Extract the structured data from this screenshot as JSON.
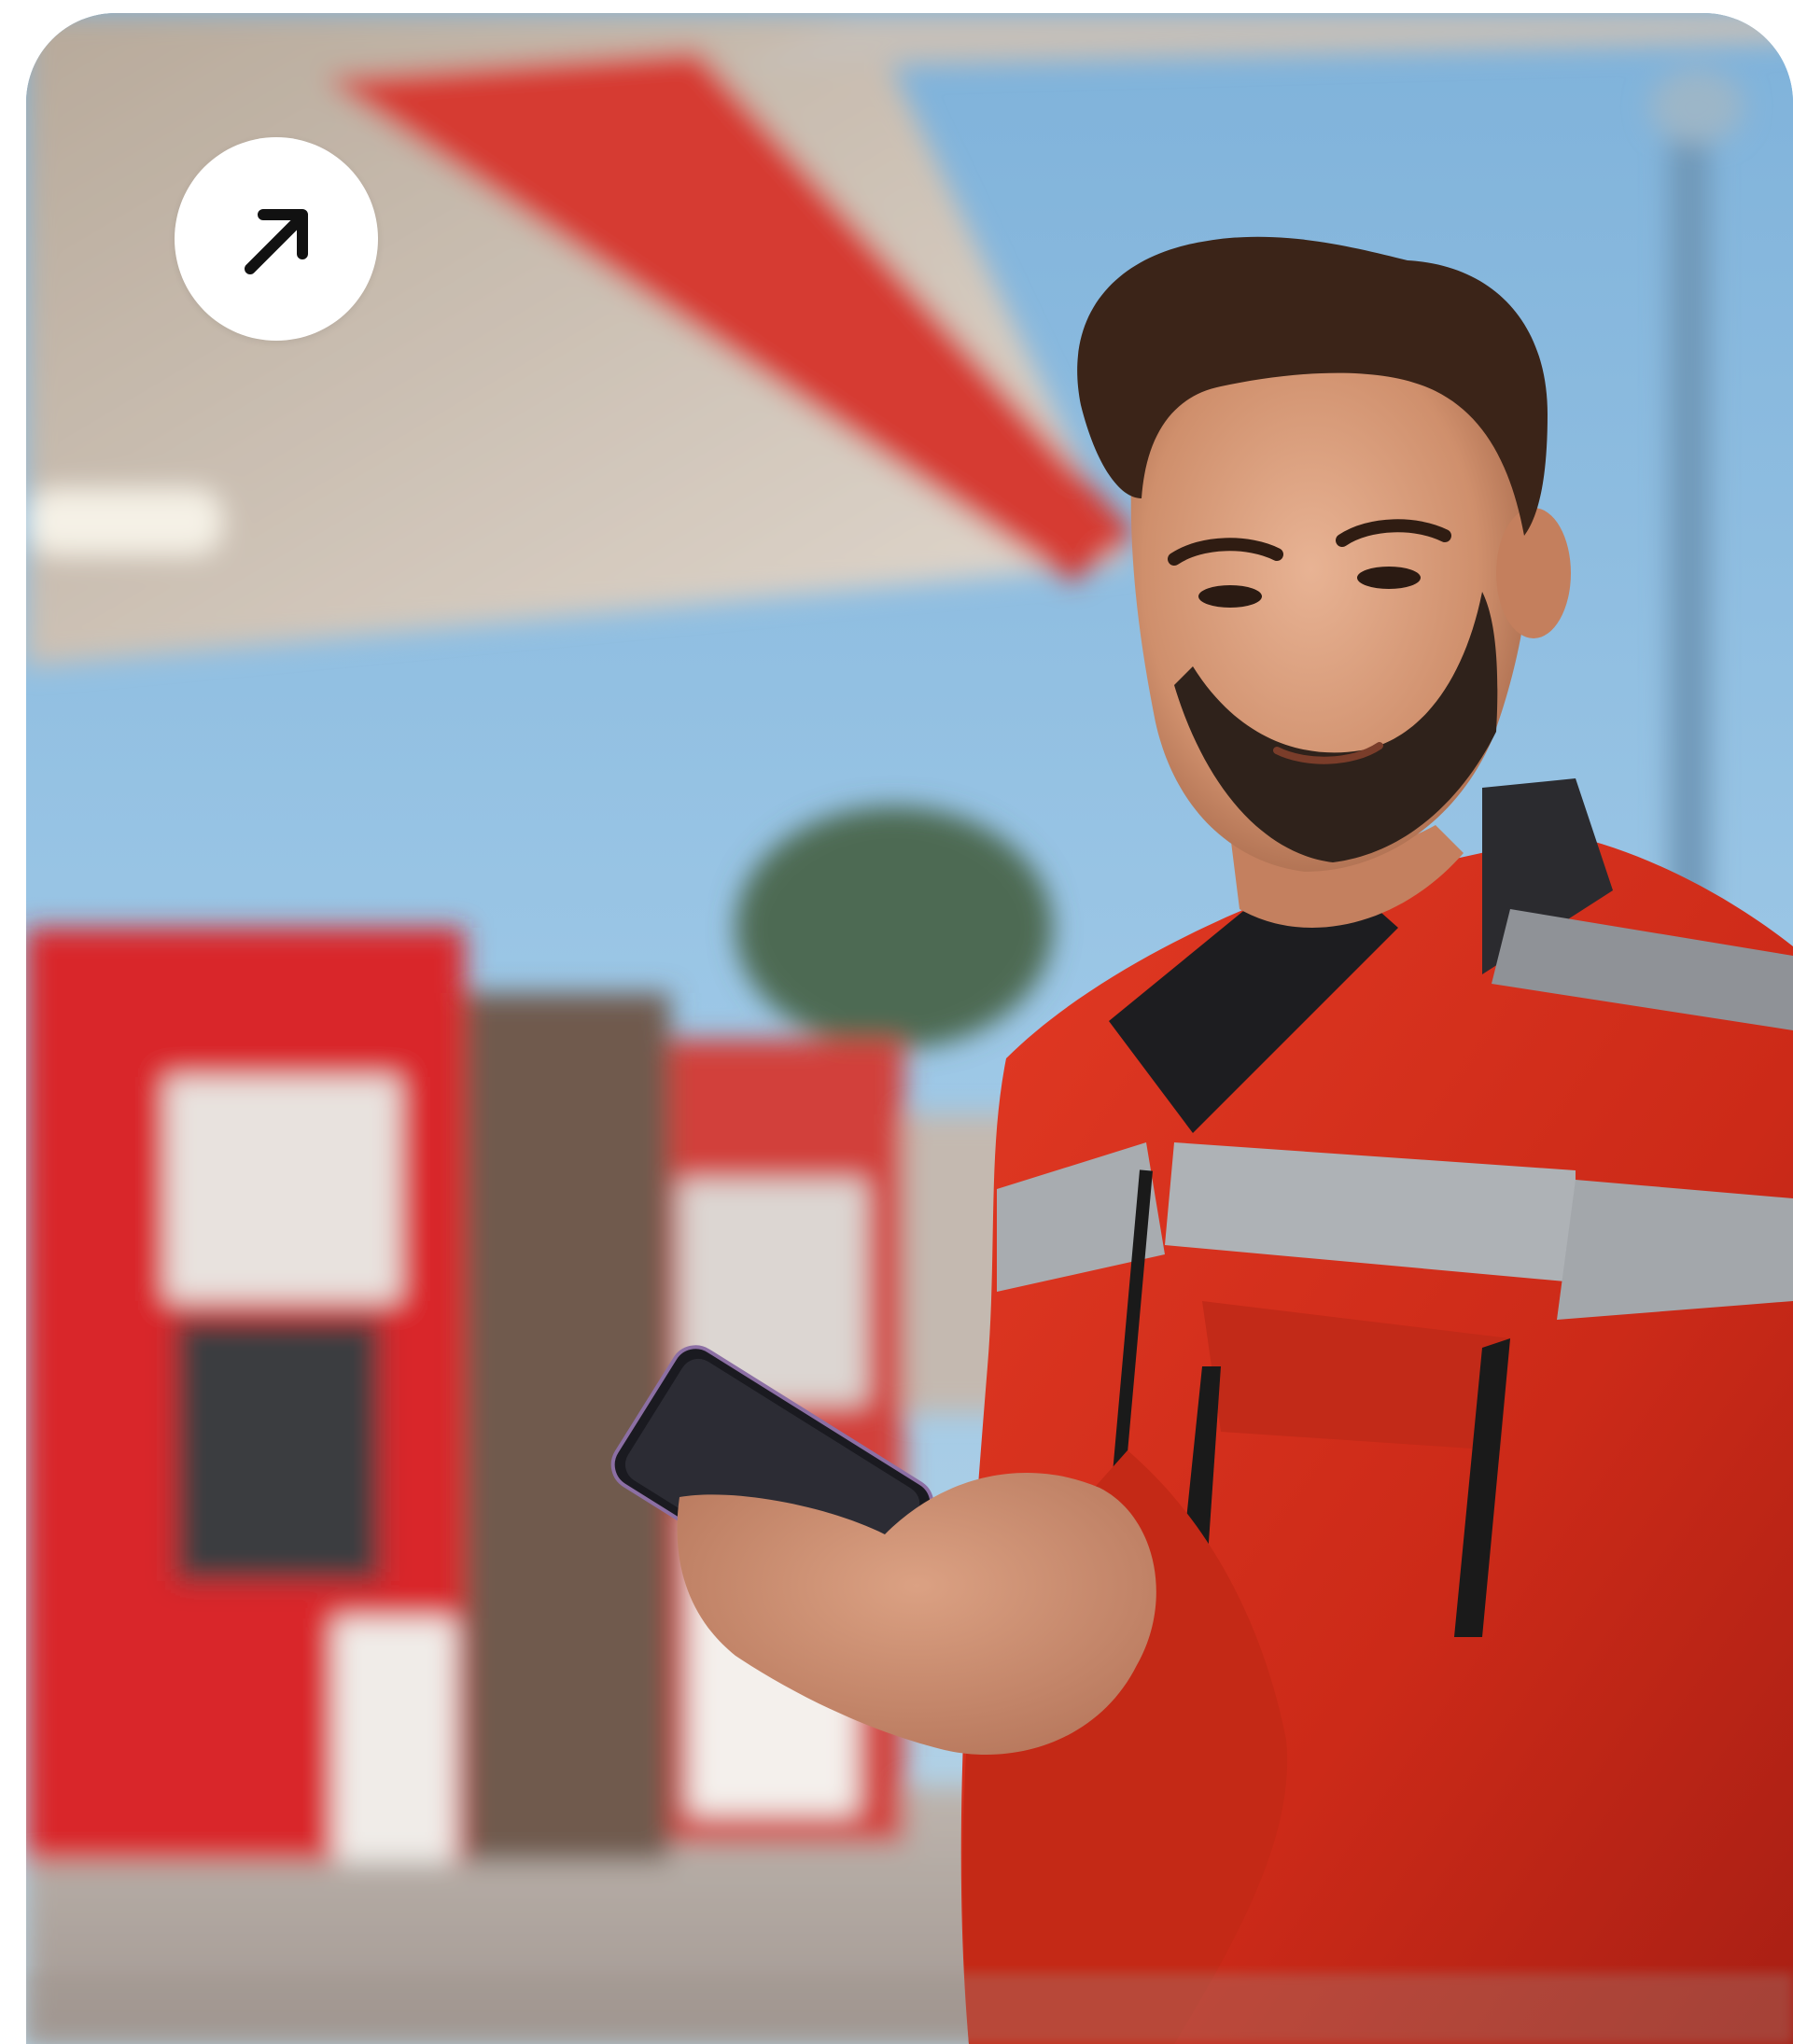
{
  "hero_card": {
    "open_button": {
      "icon": "arrow-up-right-icon"
    }
  },
  "colors": {
    "sky": "#8fbfe0",
    "canopy_underside": "#cfc6bc",
    "canopy_red": "#d9342b",
    "jacket_red": "#d8301f",
    "jacket_shadow": "#a81f14",
    "reflective_stripe": "#a9adb0",
    "phone": "#1a1a20",
    "button_bg": "#ffffff",
    "arrow": "#111111"
  }
}
